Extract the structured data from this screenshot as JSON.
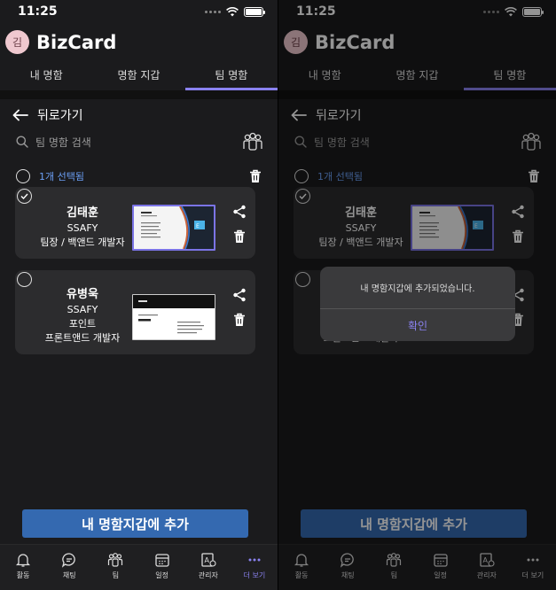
{
  "status": {
    "time": "11:25"
  },
  "app": {
    "avatar_text": "김",
    "title": "BizCard"
  },
  "tabs": [
    {
      "label": "내 명함"
    },
    {
      "label": "명함 지갑"
    },
    {
      "label": "팀 명함",
      "active": true
    }
  ],
  "back": {
    "label": "뒤로가기"
  },
  "search": {
    "placeholder": "팀 명함 검색"
  },
  "selection": {
    "count_label": "1개 선택됨"
  },
  "cards": [
    {
      "name": "김태훈",
      "company": "SSAFY",
      "role": "팀장 / 백앤드 개발자",
      "selected": true
    },
    {
      "name": "유병욱",
      "company": "SSAFY",
      "dept": "포인트",
      "role": "프론트앤드 개발자",
      "selected": false
    }
  ],
  "add_button": {
    "label": "내 명함지갑에 추가"
  },
  "nav": [
    {
      "label": "활동",
      "icon": "bell-icon"
    },
    {
      "label": "채팅",
      "icon": "chat-icon"
    },
    {
      "label": "팀",
      "icon": "team-icon"
    },
    {
      "label": "일정",
      "icon": "calendar-icon"
    },
    {
      "label": "관리자",
      "icon": "admin-icon"
    },
    {
      "label": "더 보기",
      "icon": "more-icon",
      "active": true
    }
  ],
  "dialog": {
    "message": "내 명함지갑에 추가되었습니다.",
    "confirm": "확인"
  },
  "colors": {
    "accent": "#8a82f0",
    "button": "#3469b0",
    "selection_text": "#6b9ff5"
  }
}
